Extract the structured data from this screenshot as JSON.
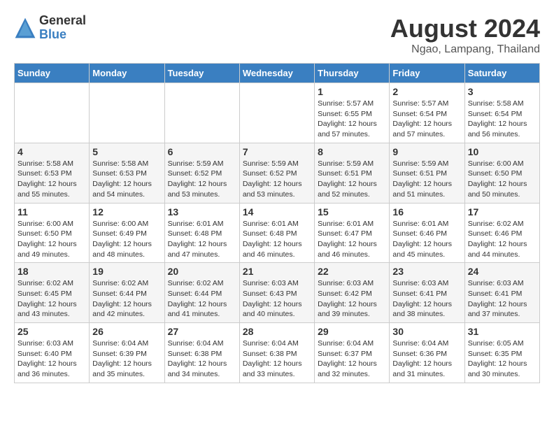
{
  "logo": {
    "general": "General",
    "blue": "Blue"
  },
  "title": "August 2024",
  "subtitle": "Ngao, Lampang, Thailand",
  "days_header": [
    "Sunday",
    "Monday",
    "Tuesday",
    "Wednesday",
    "Thursday",
    "Friday",
    "Saturday"
  ],
  "weeks": [
    [
      {
        "day": "",
        "info": ""
      },
      {
        "day": "",
        "info": ""
      },
      {
        "day": "",
        "info": ""
      },
      {
        "day": "",
        "info": ""
      },
      {
        "day": "1",
        "info": "Sunrise: 5:57 AM\nSunset: 6:55 PM\nDaylight: 12 hours\nand 57 minutes."
      },
      {
        "day": "2",
        "info": "Sunrise: 5:57 AM\nSunset: 6:54 PM\nDaylight: 12 hours\nand 57 minutes."
      },
      {
        "day": "3",
        "info": "Sunrise: 5:58 AM\nSunset: 6:54 PM\nDaylight: 12 hours\nand 56 minutes."
      }
    ],
    [
      {
        "day": "4",
        "info": "Sunrise: 5:58 AM\nSunset: 6:53 PM\nDaylight: 12 hours\nand 55 minutes."
      },
      {
        "day": "5",
        "info": "Sunrise: 5:58 AM\nSunset: 6:53 PM\nDaylight: 12 hours\nand 54 minutes."
      },
      {
        "day": "6",
        "info": "Sunrise: 5:59 AM\nSunset: 6:52 PM\nDaylight: 12 hours\nand 53 minutes."
      },
      {
        "day": "7",
        "info": "Sunrise: 5:59 AM\nSunset: 6:52 PM\nDaylight: 12 hours\nand 53 minutes."
      },
      {
        "day": "8",
        "info": "Sunrise: 5:59 AM\nSunset: 6:51 PM\nDaylight: 12 hours\nand 52 minutes."
      },
      {
        "day": "9",
        "info": "Sunrise: 5:59 AM\nSunset: 6:51 PM\nDaylight: 12 hours\nand 51 minutes."
      },
      {
        "day": "10",
        "info": "Sunrise: 6:00 AM\nSunset: 6:50 PM\nDaylight: 12 hours\nand 50 minutes."
      }
    ],
    [
      {
        "day": "11",
        "info": "Sunrise: 6:00 AM\nSunset: 6:50 PM\nDaylight: 12 hours\nand 49 minutes."
      },
      {
        "day": "12",
        "info": "Sunrise: 6:00 AM\nSunset: 6:49 PM\nDaylight: 12 hours\nand 48 minutes."
      },
      {
        "day": "13",
        "info": "Sunrise: 6:01 AM\nSunset: 6:48 PM\nDaylight: 12 hours\nand 47 minutes."
      },
      {
        "day": "14",
        "info": "Sunrise: 6:01 AM\nSunset: 6:48 PM\nDaylight: 12 hours\nand 46 minutes."
      },
      {
        "day": "15",
        "info": "Sunrise: 6:01 AM\nSunset: 6:47 PM\nDaylight: 12 hours\nand 46 minutes."
      },
      {
        "day": "16",
        "info": "Sunrise: 6:01 AM\nSunset: 6:46 PM\nDaylight: 12 hours\nand 45 minutes."
      },
      {
        "day": "17",
        "info": "Sunrise: 6:02 AM\nSunset: 6:46 PM\nDaylight: 12 hours\nand 44 minutes."
      }
    ],
    [
      {
        "day": "18",
        "info": "Sunrise: 6:02 AM\nSunset: 6:45 PM\nDaylight: 12 hours\nand 43 minutes."
      },
      {
        "day": "19",
        "info": "Sunrise: 6:02 AM\nSunset: 6:44 PM\nDaylight: 12 hours\nand 42 minutes."
      },
      {
        "day": "20",
        "info": "Sunrise: 6:02 AM\nSunset: 6:44 PM\nDaylight: 12 hours\nand 41 minutes."
      },
      {
        "day": "21",
        "info": "Sunrise: 6:03 AM\nSunset: 6:43 PM\nDaylight: 12 hours\nand 40 minutes."
      },
      {
        "day": "22",
        "info": "Sunrise: 6:03 AM\nSunset: 6:42 PM\nDaylight: 12 hours\nand 39 minutes."
      },
      {
        "day": "23",
        "info": "Sunrise: 6:03 AM\nSunset: 6:41 PM\nDaylight: 12 hours\nand 38 minutes."
      },
      {
        "day": "24",
        "info": "Sunrise: 6:03 AM\nSunset: 6:41 PM\nDaylight: 12 hours\nand 37 minutes."
      }
    ],
    [
      {
        "day": "25",
        "info": "Sunrise: 6:03 AM\nSunset: 6:40 PM\nDaylight: 12 hours\nand 36 minutes."
      },
      {
        "day": "26",
        "info": "Sunrise: 6:04 AM\nSunset: 6:39 PM\nDaylight: 12 hours\nand 35 minutes."
      },
      {
        "day": "27",
        "info": "Sunrise: 6:04 AM\nSunset: 6:38 PM\nDaylight: 12 hours\nand 34 minutes."
      },
      {
        "day": "28",
        "info": "Sunrise: 6:04 AM\nSunset: 6:38 PM\nDaylight: 12 hours\nand 33 minutes."
      },
      {
        "day": "29",
        "info": "Sunrise: 6:04 AM\nSunset: 6:37 PM\nDaylight: 12 hours\nand 32 minutes."
      },
      {
        "day": "30",
        "info": "Sunrise: 6:04 AM\nSunset: 6:36 PM\nDaylight: 12 hours\nand 31 minutes."
      },
      {
        "day": "31",
        "info": "Sunrise: 6:05 AM\nSunset: 6:35 PM\nDaylight: 12 hours\nand 30 minutes."
      }
    ]
  ]
}
